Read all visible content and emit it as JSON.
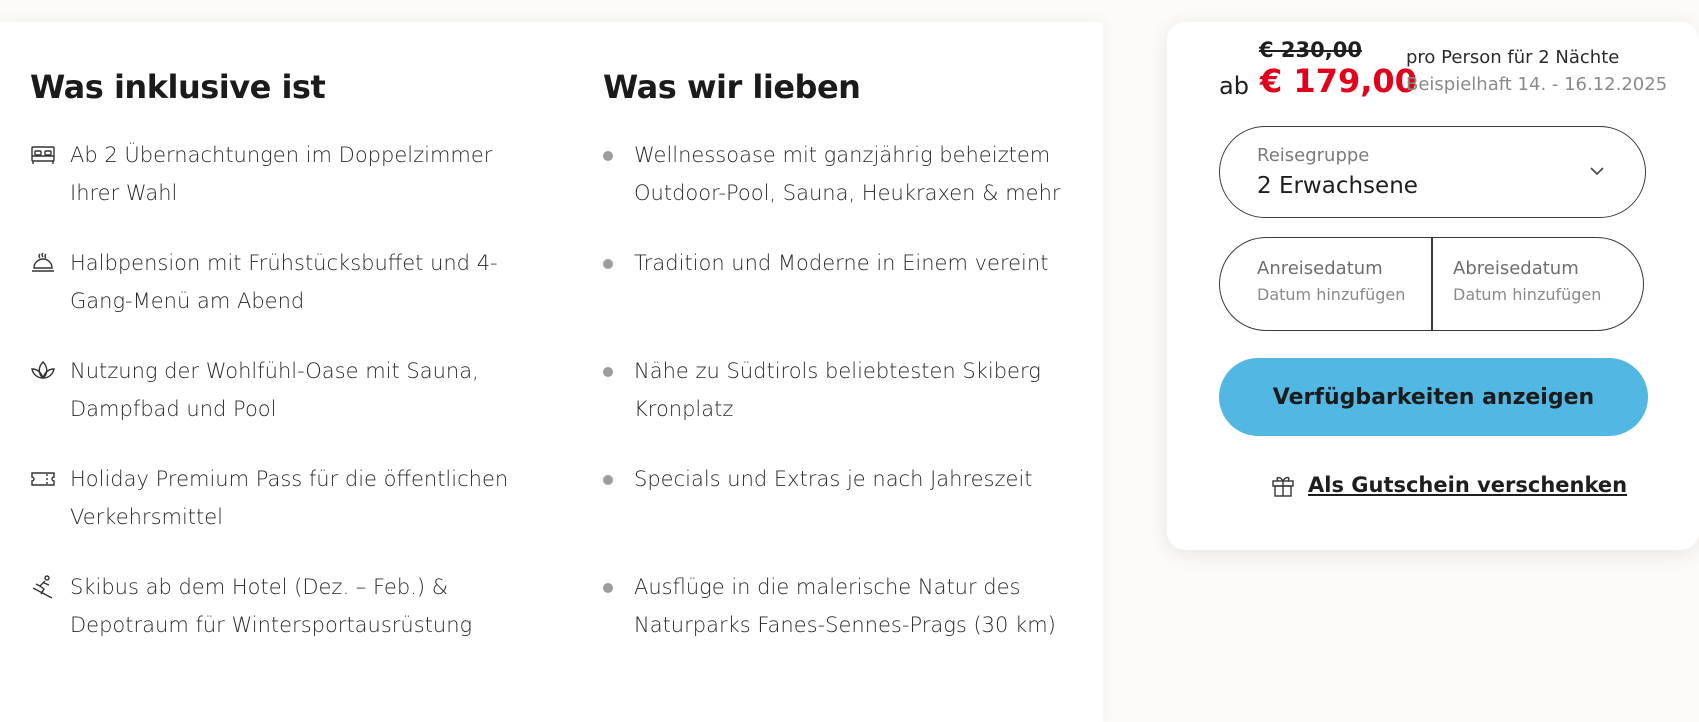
{
  "included": {
    "title": "Was inklusive ist",
    "items": [
      {
        "icon": "bed-icon",
        "text": "Ab 2 Übernachtungen im Doppelzimmer Ihrer Wahl"
      },
      {
        "icon": "dining-icon",
        "text": "Halbpension mit Frühstücksbuffet und 4-Gang-Menü am Abend"
      },
      {
        "icon": "lotus-icon",
        "text": "Nutzung der Wohlfühl-Oase mit Sauna, Dampfbad und Pool"
      },
      {
        "icon": "ticket-icon",
        "text": "Holiday Premium Pass für die öffentlichen Verkehrsmittel"
      },
      {
        "icon": "skier-icon",
        "text": "Skibus ab dem Hotel (Dez. – Feb.) & Depotraum für Wintersportausrüstung"
      }
    ]
  },
  "love": {
    "title": "Was wir lieben",
    "items": [
      "Wellnessoase mit ganzjährig beheiztem Outdoor-Pool, Sauna, Heukraxen & mehr",
      "Tradition und Moderne in Einem vereint",
      "Nähe zu Südtirols beliebtesten Skiberg Kronplatz",
      "Specials und Extras je nach Jahreszeit",
      "Ausflüge in die malerische Natur des Naturparks Fanes-Sennes-Prags (30 km)"
    ]
  },
  "booking": {
    "old_price": "€ 230,00",
    "prefix": "ab",
    "price": "€ 179,00",
    "per_person": "pro Person für 2 Nächte",
    "example_dates": "Beispielhaft 14. - 16.12.2025",
    "group_label": "Reisegruppe",
    "group_value": "2 Erwachsene",
    "arrival_label": "Anreisedatum",
    "arrival_placeholder": "Datum hinzufügen",
    "departure_label": "Abreisedatum",
    "departure_placeholder": "Datum hinzufügen",
    "cta_label": "Verfügbarkeiten anzeigen",
    "gift_label": "Als Gutschein verschenken"
  },
  "colors": {
    "price": "#e2001a",
    "cta": "#52b8e3"
  }
}
